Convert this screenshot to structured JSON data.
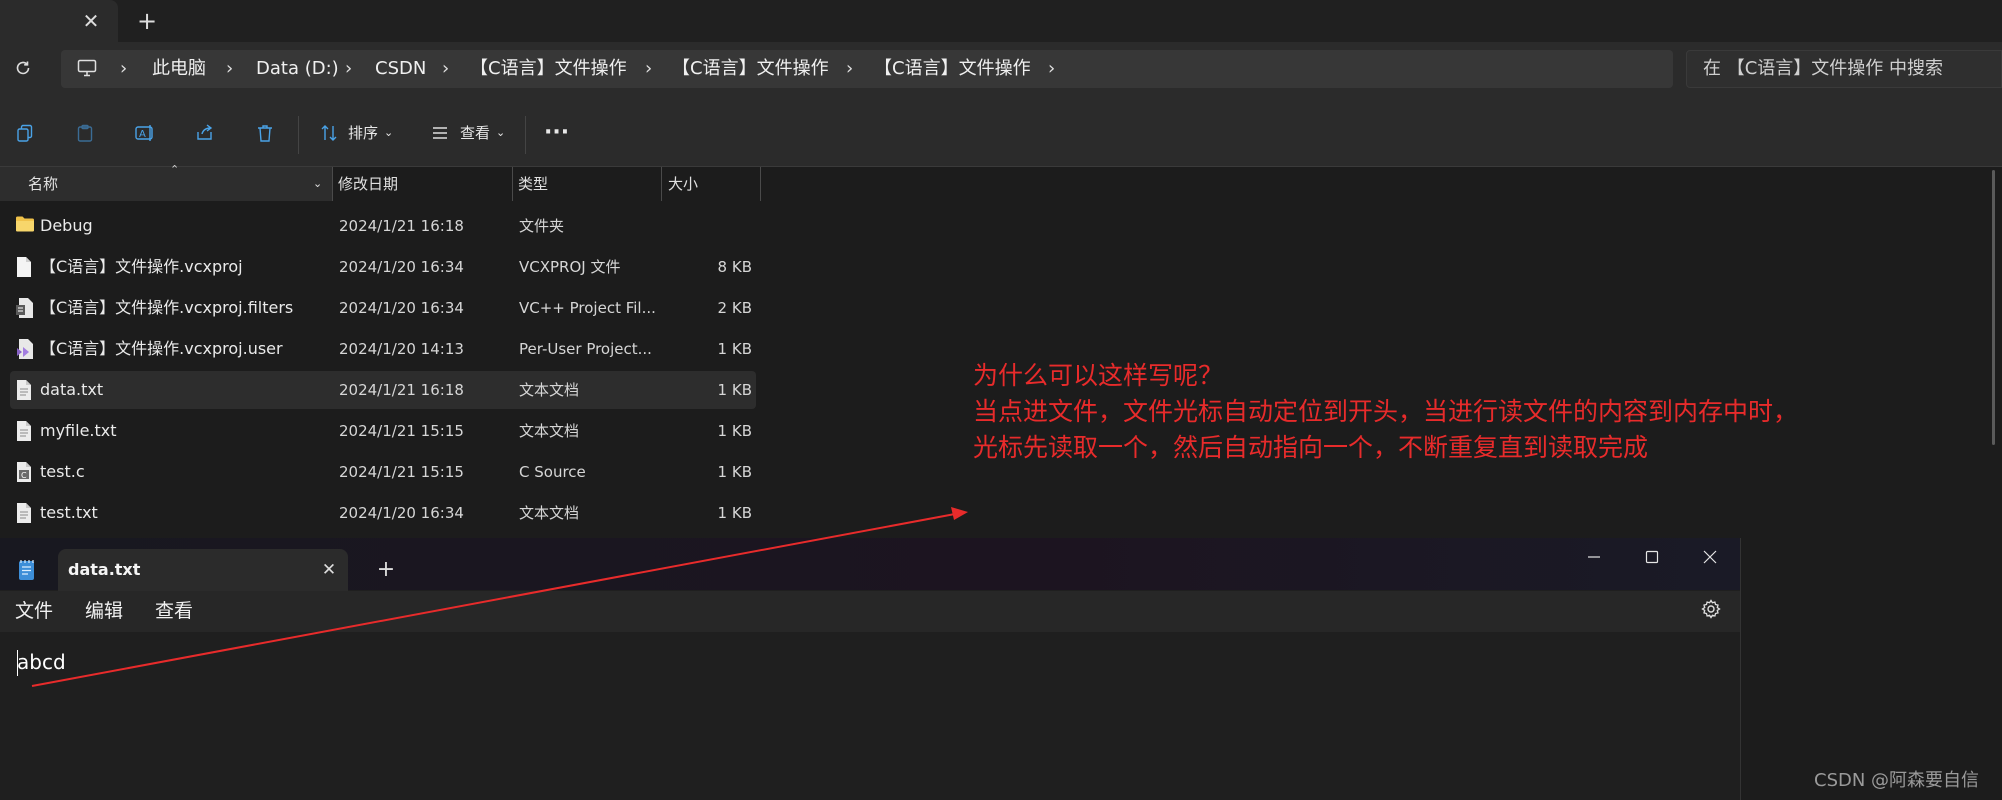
{
  "tabs": {
    "new_tab_label": "+"
  },
  "address": {
    "crumbs": [
      "此电脑",
      "Data (D:)",
      "CSDN",
      "【C语言】文件操作",
      "【C语言】文件操作",
      "【C语言】文件操作"
    ],
    "separator": "›"
  },
  "search": {
    "placeholder": "在 【C语言】文件操作 中搜索"
  },
  "toolbar": {
    "sort_label": "排序",
    "view_label": "查看",
    "more_label": "···"
  },
  "columns": {
    "name": "名称",
    "modified": "修改日期",
    "type": "类型",
    "size": "大小"
  },
  "files": [
    {
      "name": "Debug",
      "modified": "2024/1/21 16:18",
      "type": "文件夹",
      "size": "",
      "icon": "folder-icon",
      "selected": false
    },
    {
      "name": "【C语言】文件操作.vcxproj",
      "modified": "2024/1/20 16:34",
      "type": "VCXPROJ 文件",
      "size": "8 KB",
      "icon": "file-icon",
      "selected": false
    },
    {
      "name": "【C语言】文件操作.vcxproj.filters",
      "modified": "2024/1/20 16:34",
      "type": "VC++ Project Fil...",
      "size": "2 KB",
      "icon": "vcxproj-filters-icon",
      "selected": false
    },
    {
      "name": "【C语言】文件操作.vcxproj.user",
      "modified": "2024/1/20 14:13",
      "type": "Per-User Project...",
      "size": "1 KB",
      "icon": "vs-user-file-icon",
      "selected": false
    },
    {
      "name": "data.txt",
      "modified": "2024/1/21 16:18",
      "type": "文本文档",
      "size": "1 KB",
      "icon": "text-file-icon",
      "selected": true
    },
    {
      "name": "myfile.txt",
      "modified": "2024/1/21 15:15",
      "type": "文本文档",
      "size": "1 KB",
      "icon": "text-file-icon",
      "selected": false
    },
    {
      "name": "test.c",
      "modified": "2024/1/21 15:15",
      "type": "C Source",
      "size": "1 KB",
      "icon": "c-source-icon",
      "selected": false
    },
    {
      "name": "test.txt",
      "modified": "2024/1/20 16:34",
      "type": "文本文档",
      "size": "1 KB",
      "icon": "text-file-icon",
      "selected": false
    }
  ],
  "annotation": {
    "line1": "为什么可以这样写呢？",
    "line2": "当点进文件，文件光标自动定位到开头，当进行读文件的内容到内存中时，",
    "line3": "光标先读取一个，然后自动指向一个，不断重复直到读取完成",
    "color": "#e82b2b"
  },
  "notepad": {
    "tab_title": "data.txt",
    "menu": [
      "文件",
      "编辑",
      "查看"
    ],
    "content": "abcd"
  },
  "watermark": "CSDN @阿森要自信"
}
